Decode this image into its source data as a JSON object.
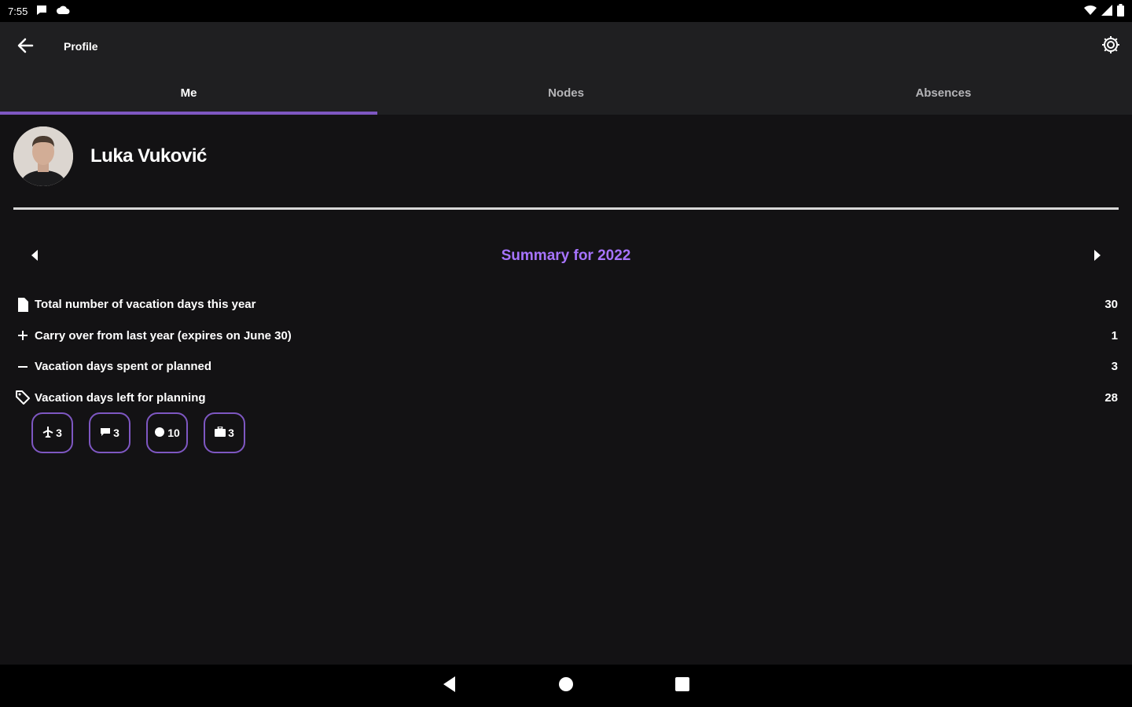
{
  "status_bar": {
    "time": "7:55",
    "icons": [
      "chat-icon",
      "cloud-icon",
      "wifi-icon",
      "signal-icon",
      "battery-icon"
    ]
  },
  "app_bar": {
    "title": "Profile",
    "back_icon": "arrow-left-icon",
    "settings_icon": "gear-icon"
  },
  "tabs": [
    {
      "label": "Me",
      "active": true
    },
    {
      "label": "Nodes",
      "active": false
    },
    {
      "label": "Absences",
      "active": false
    }
  ],
  "profile": {
    "name": "Luka Vuković"
  },
  "summary": {
    "title": "Summary for 2022",
    "stats": [
      {
        "icon": "document-icon",
        "label": "Total number of vacation days this year",
        "value": "30"
      },
      {
        "icon": "plus-icon",
        "label": "Carry over from last year (expires on June 30)",
        "value": "1"
      },
      {
        "icon": "minus-icon",
        "label": "Vacation days spent or planned",
        "value": "3"
      },
      {
        "icon": "tag-icon",
        "label": "Vacation days left for planning",
        "value": "28"
      }
    ]
  },
  "chips": [
    {
      "icon": "plane-icon",
      "count": "3"
    },
    {
      "icon": "chat-icon",
      "count": "3"
    },
    {
      "icon": "coin-icon",
      "count": "10"
    },
    {
      "icon": "briefcase-icon",
      "count": "3"
    }
  ],
  "colors": {
    "accent": "#7e57c2",
    "summary_title": "#a774ff",
    "background": "#131214",
    "bar": "#1f1f21"
  }
}
